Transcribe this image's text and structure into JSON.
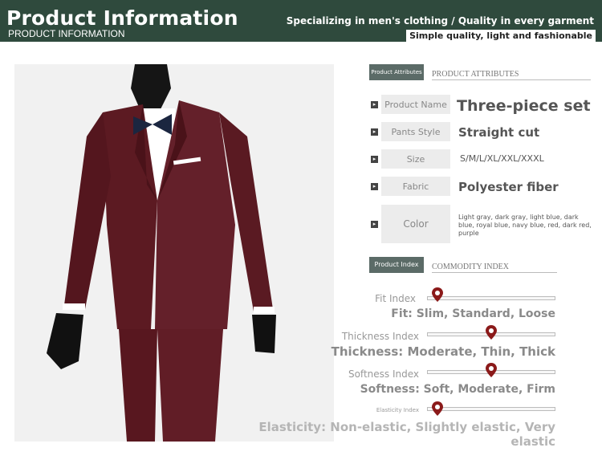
{
  "header": {
    "title": "Product Information",
    "subtitle": "PRODUCT INFORMATION",
    "slogan": "Specializing in men's clothing / Quality in every garment",
    "slogan2": "Simple quality, light and fashionable"
  },
  "attributes_section": {
    "badge": "Product Attributes",
    "label": "PRODUCT ATTRIBUTES"
  },
  "attributes": {
    "product_name": {
      "label": "Product Name",
      "value": "Three-piece set"
    },
    "pants_style": {
      "label": "Pants Style",
      "value": "Straight cut"
    },
    "size": {
      "label": "Size",
      "value": "S/M/L/XL/XXL/XXXL"
    },
    "fabric": {
      "label": "Fabric",
      "value": "Polyester fiber"
    },
    "color": {
      "label": "Color",
      "value": "Light gray, dark gray, light blue, dark blue, royal blue, navy blue, red, dark red, purple"
    }
  },
  "index_section": {
    "badge": "Product Index",
    "label": "COMMODITY INDEX"
  },
  "indexes": {
    "fit": {
      "label": "Fit Index",
      "desc": "Fit: Slim, Standard, Loose",
      "level": 0.08
    },
    "thickness": {
      "label": "Thickness Index",
      "desc": "Thickness: Moderate, Thin, Thick",
      "level": 0.5
    },
    "softness": {
      "label": "Softness Index",
      "desc": "Softness: Soft, Moderate, Firm",
      "level": 0.5
    },
    "elasticity": {
      "label": "Elasticity Index",
      "desc": "Elasticity: Non-elastic, Slightly elastic, Very elastic",
      "level": 0.08
    }
  },
  "colors": {
    "banner": "#2f4a3d",
    "pin": "#8b1a1a",
    "suit": "#5c1a22"
  }
}
